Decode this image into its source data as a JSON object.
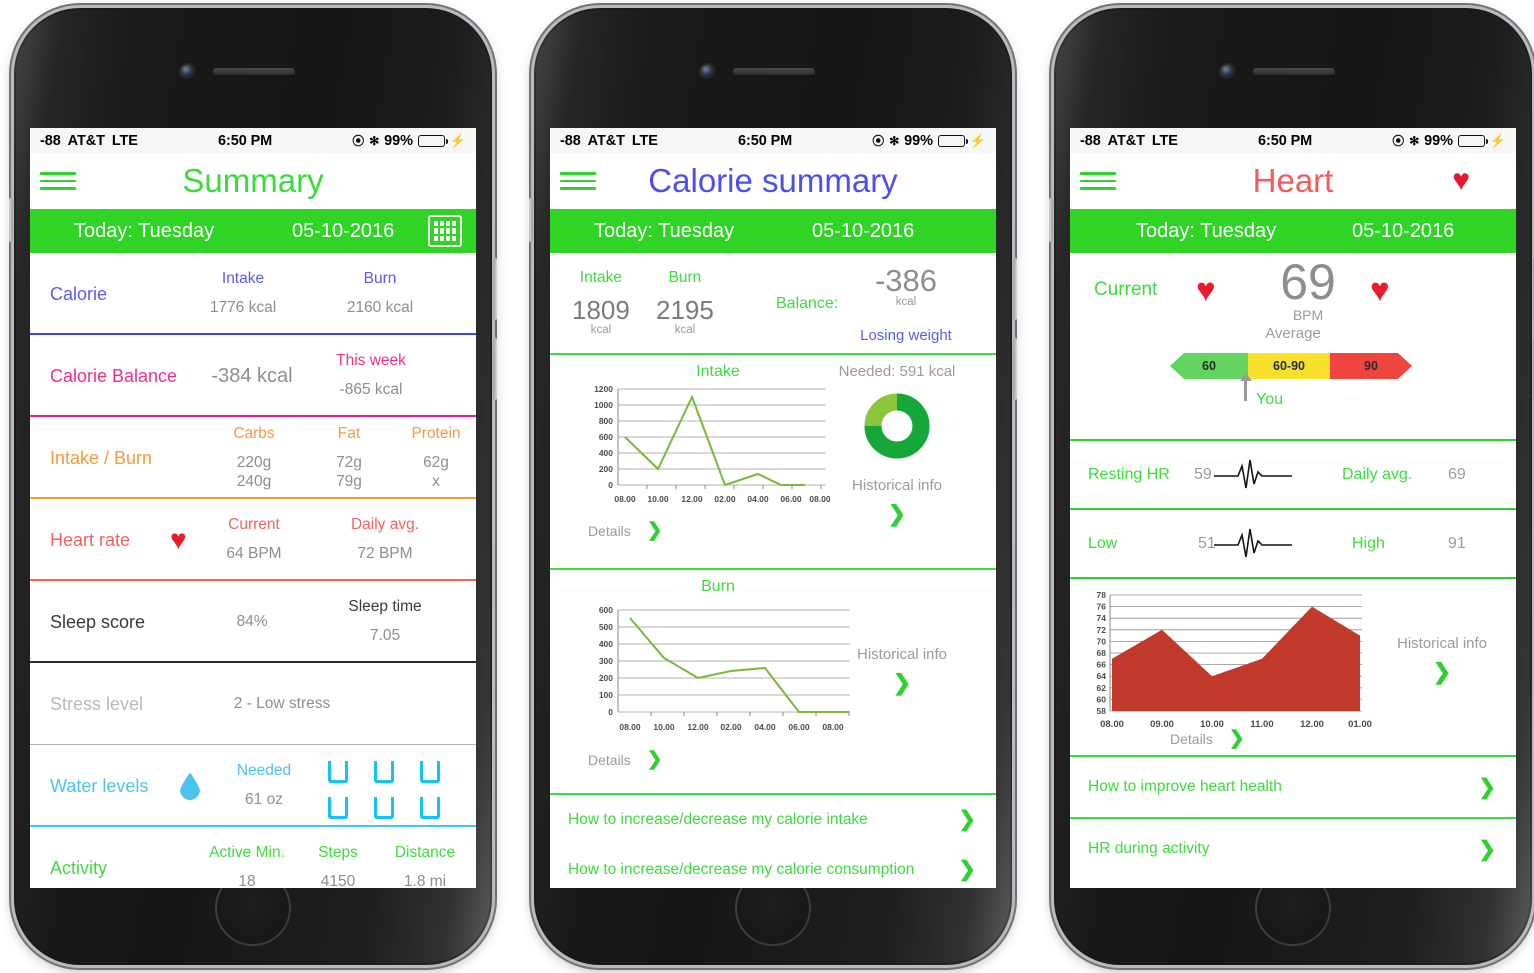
{
  "status_bar": {
    "signal": "-88",
    "carrier": "AT&T",
    "network": "LTE",
    "time": "6:50 PM",
    "battery_pct": "99%",
    "lock_icon": "rotation-lock-icon",
    "bluetooth_icon": "bluetooth-icon",
    "battery_icon": "battery-icon",
    "charging_icon": "charging-bolt-icon"
  },
  "colors": {
    "green": "#2fd424",
    "bright_green": "#3ddb3d",
    "blue": "#5b5bf0",
    "pink": "#ef2f8a",
    "orange": "#f79a3c",
    "red": "#f4645e",
    "cyan": "#4cc3ef",
    "heart_red": "#ea1b2d",
    "grey_value": "#8e8e8e"
  },
  "phone1": {
    "menu_icon": "hamburger-menu-icon",
    "title": "Summary",
    "datebar": {
      "today": "Today: Tuesday",
      "date": "05-10-2016",
      "calendar_icon": "calendar-icon"
    },
    "rows": [
      {
        "label": "Calorie",
        "color": "c-blue",
        "rule": "#4242e8",
        "cols": [
          {
            "head": "Intake",
            "value": "1776 kcal",
            "x": 213
          },
          {
            "head": "Burn",
            "value": "2160 kcal",
            "x": 350
          }
        ]
      },
      {
        "label": "Calorie Balance",
        "color": "c-pink",
        "rule": "#e0219a",
        "cols": [
          {
            "head": "",
            "value": "-384 kcal",
            "x": 222,
            "big": true
          },
          {
            "head": "This week",
            "value": "-865 kcal",
            "x": 341
          }
        ]
      },
      {
        "label": "Intake / Burn",
        "color": "c-orange",
        "rule": "#f79a3c",
        "cols": [
          {
            "head": "Carbs",
            "value": "220g\n240g",
            "x": 224
          },
          {
            "head": "Fat",
            "value": "72g\n79g",
            "x": 319
          },
          {
            "head": "Protein",
            "value": "62g\nx",
            "x": 406
          }
        ]
      },
      {
        "label": "Heart rate",
        "color": "c-red",
        "rule": "#f4645e",
        "heart_icon": "heart-icon",
        "cols": [
          {
            "head": "Current",
            "value": "64 BPM",
            "x": 224
          },
          {
            "head": "Daily avg.",
            "value": "72 BPM",
            "x": 355
          }
        ]
      },
      {
        "label": "Sleep score",
        "color": "c-dark",
        "rule": "#2b2b2b",
        "cols": [
          {
            "head": "",
            "value": "84%",
            "x": 222
          },
          {
            "head": "Sleep time",
            "value": "7.05",
            "x": 355
          }
        ]
      },
      {
        "label": "Stress level",
        "color": "c-grey",
        "rule": "#b0b0b0",
        "cols": [
          {
            "head": "",
            "value": "2 - Low stress",
            "x": 252
          }
        ]
      },
      {
        "label": "Water levels",
        "color": "c-cyan",
        "rule": "#4cc3ef",
        "drop_icon": "water-drop-icon",
        "glasses": 6,
        "cols": [
          {
            "head": "Needed",
            "value": "61 oz",
            "x": 234
          }
        ]
      },
      {
        "label": "Activity",
        "color": "c-green",
        "rule": "#2fd12f",
        "cols": [
          {
            "head": "Active Min.",
            "value": "18",
            "x": 217
          },
          {
            "head": "Steps",
            "value": "4150",
            "x": 308
          },
          {
            "head": "Distance",
            "value": "1.8 mi",
            "x": 395
          }
        ]
      }
    ]
  },
  "phone2": {
    "menu_icon": "hamburger-menu-icon",
    "title": "Calorie summary",
    "datebar": {
      "today": "Today: Tuesday",
      "date": "05-10-2016"
    },
    "summary": {
      "intake_label": "Intake",
      "intake_value": "1809",
      "intake_unit": "kcal",
      "burn_label": "Burn",
      "burn_value": "2195",
      "burn_unit": "kcal",
      "balance_label": "Balance:",
      "balance_value": "-386",
      "balance_unit": "kcal",
      "balance_note": "Losing weight"
    },
    "intake_panel": {
      "title": "Intake",
      "needed": "Needed: 591 kcal",
      "donut_icon": "donut-progress-icon",
      "side_note": "Historical info",
      "side_chevron": "chevron-right-icon",
      "details": "Details",
      "details_chevron": "chevron-right-icon"
    },
    "burn_panel": {
      "title": "Burn",
      "side_note": "Historical info",
      "side_chevron": "chevron-right-icon",
      "details": "Details",
      "details_chevron": "chevron-right-icon"
    },
    "links": [
      {
        "text": "How to increase/decrease my calorie intake",
        "chevron": "chevron-right-icon"
      },
      {
        "text": "How to increase/decrease my calorie consumption",
        "chevron": "chevron-right-icon"
      }
    ]
  },
  "phone3": {
    "menu_icon": "hamburger-menu-icon",
    "title": "Heart",
    "title_heart_icon": "heart-icon",
    "datebar": {
      "today": "Today: Tuesday",
      "date": "05-10-2016"
    },
    "current": {
      "label": "Current",
      "heart_icon_left": "heart-icon",
      "heart_icon_right": "heart-icon",
      "bpm_value": "69",
      "bpm_unit": "BPM",
      "average_label": "Average",
      "gauge": [
        {
          "label": "60",
          "color": "#62d45f"
        },
        {
          "label": "60-90",
          "color": "#f7e12c"
        },
        {
          "label": "90",
          "color": "#f0453e"
        }
      ],
      "marker_label": "You",
      "marker_icon": "up-arrow-icon"
    },
    "rows": [
      {
        "k1": "Resting HR",
        "v1": "59",
        "icon": "ekg-pulse-icon",
        "k2": "Daily avg.",
        "v2": "69"
      },
      {
        "k1": "Low",
        "v1": "51",
        "icon": "ekg-pulse-icon",
        "k2": "High",
        "v2": "91"
      }
    ],
    "chart_panel": {
      "side_note": "Historical info",
      "side_chevron": "chevron-right-icon",
      "details": "Details",
      "details_chevron": "chevron-right-icon"
    },
    "links": [
      {
        "text": "How to improve heart health",
        "chevron": "chevron-right-icon"
      },
      {
        "text": "HR during activity",
        "chevron": "chevron-right-icon"
      }
    ]
  },
  "chart_data": [
    {
      "id": "intake_chart",
      "type": "line",
      "title": "Intake",
      "xlabel": "",
      "ylabel": "",
      "ylim": [
        0,
        1200
      ],
      "yticks": [
        0,
        200,
        400,
        600,
        800,
        1000,
        1200
      ],
      "categories": [
        "08.00",
        "10.00",
        "12.00",
        "02.00",
        "04.00",
        "06.00",
        "08.00"
      ],
      "x": [
        "08.00",
        "11.00",
        "12.00",
        "02.00",
        "04.00",
        "05.00",
        "06.00"
      ],
      "values": [
        600,
        200,
        1090,
        0,
        140,
        0,
        0
      ],
      "line_color": "#7ab83a",
      "grid": true,
      "legend": "none"
    },
    {
      "id": "burn_chart",
      "type": "line",
      "title": "Burn",
      "xlabel": "",
      "ylabel": "",
      "ylim": [
        0,
        600
      ],
      "yticks": [
        0,
        100,
        200,
        300,
        400,
        500,
        600
      ],
      "categories": [
        "08.00",
        "10.00",
        "12.00",
        "02.00",
        "04.00",
        "06.00",
        "08.00"
      ],
      "values": [
        550,
        320,
        200,
        240,
        260,
        0,
        0
      ],
      "line_color": "#7ab83a",
      "grid": true,
      "legend": "none"
    },
    {
      "id": "heart_rate_chart",
      "type": "area",
      "title": "",
      "xlabel": "",
      "ylabel": "",
      "ylim": [
        58,
        78
      ],
      "yticks": [
        58,
        60,
        62,
        64,
        66,
        68,
        70,
        72,
        74,
        76,
        78
      ],
      "categories": [
        "08.00",
        "09.00",
        "10.00",
        "11.00",
        "12.00",
        "01.00"
      ],
      "values": [
        67,
        72,
        64,
        67,
        76,
        71
      ],
      "area_color": "#c0392b",
      "grid": true,
      "legend": "none"
    },
    {
      "id": "intake_donut",
      "type": "pie",
      "title": "Needed: 591 kcal",
      "categories": [
        "consumed",
        "remaining"
      ],
      "values": [
        75,
        25
      ],
      "colors": [
        "#15a838",
        "#8cc63f"
      ]
    }
  ]
}
